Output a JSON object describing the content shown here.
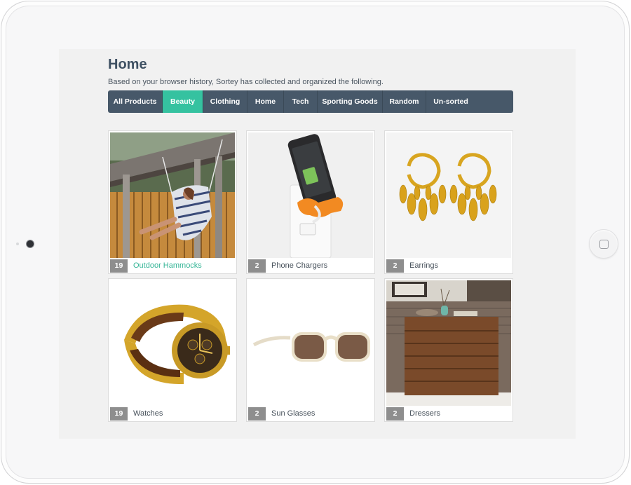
{
  "page": {
    "title": "Home",
    "subtitle": "Based on your browser history, Sortey has collected and organized the following."
  },
  "nav": {
    "tabs": [
      {
        "label": "All Products",
        "active": false
      },
      {
        "label": "Beauty",
        "active": true
      },
      {
        "label": "Clothing",
        "active": false
      },
      {
        "label": "Home",
        "active": false
      },
      {
        "label": "Tech",
        "active": false
      },
      {
        "label": "Sporting Goods",
        "active": false
      },
      {
        "label": "Random",
        "active": false
      },
      {
        "label": "Un-sorted",
        "active": false
      }
    ]
  },
  "products": [
    {
      "count": "19",
      "label": "Outdoor Hammocks",
      "image": "hammock-photo",
      "highlight": true
    },
    {
      "count": "2",
      "label": "Phone Chargers",
      "image": "phone-charger-photo",
      "highlight": false
    },
    {
      "count": "2",
      "label": "Earrings",
      "image": "earrings-photo",
      "highlight": false
    },
    {
      "count": "19",
      "label": "Watches",
      "image": "watch-photo",
      "highlight": false
    },
    {
      "count": "2",
      "label": "Sun Glasses",
      "image": "sunglasses-photo",
      "highlight": false
    },
    {
      "count": "2",
      "label": "Dressers",
      "image": "dresser-photo",
      "highlight": false
    }
  ],
  "colors": {
    "accent": "#35c2a0",
    "nav_background": "#475869",
    "title": "#3f5163",
    "count_badge": "#8e8e8e"
  }
}
